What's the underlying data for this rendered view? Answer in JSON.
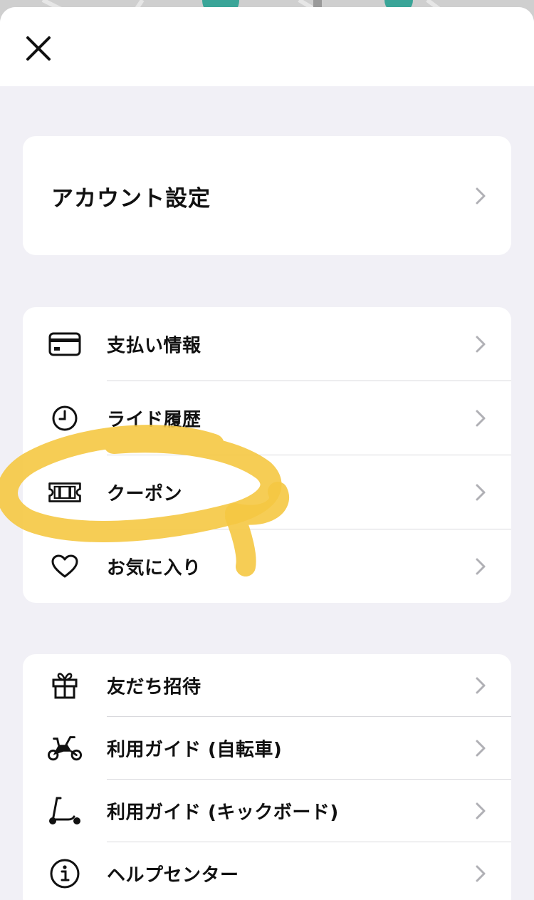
{
  "header": {
    "close_icon": "close-icon"
  },
  "account": {
    "label": "アカウント設定"
  },
  "menu": {
    "payment": {
      "label": "支払い情報",
      "icon": "credit-card-icon"
    },
    "history": {
      "label": "ライド履歴",
      "icon": "clock-icon"
    },
    "coupon": {
      "label": "クーポン",
      "icon": "ticket-icon"
    },
    "favorites": {
      "label": "お気に入り",
      "icon": "heart-icon"
    }
  },
  "guides": {
    "invite": {
      "label": "友だち招待",
      "icon": "gift-icon"
    },
    "bike_guide": {
      "label": "利用ガイド (自転車)",
      "icon": "bicycle-icon"
    },
    "kickboard_guide": {
      "label": "利用ガイド (キックボード)",
      "icon": "kick-scooter-icon"
    },
    "help": {
      "label": "ヘルプセンター",
      "icon": "info-icon"
    }
  },
  "colors": {
    "background": "#f1f0f6",
    "card": "#ffffff",
    "highlight": "#f5c842",
    "chevron": "#b0b0b5",
    "divider": "#d9d9dd"
  }
}
